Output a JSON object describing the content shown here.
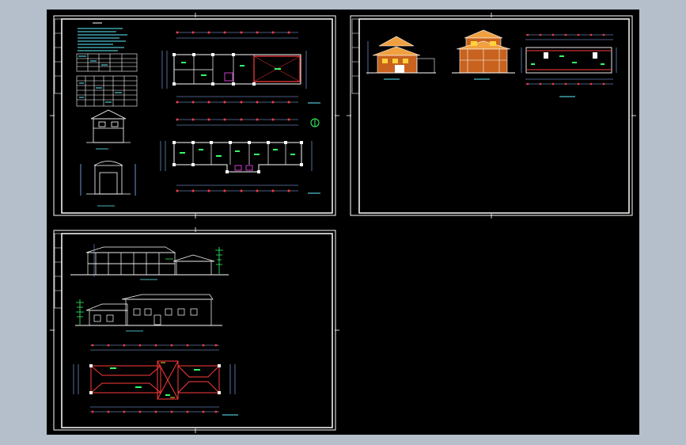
{
  "viewer": {
    "background": "#b5bfcc",
    "canvas_color": "#000000"
  },
  "colors": {
    "frame": "#ffffff",
    "dimension": "#8fb8ff",
    "column": "#ff3b3b",
    "wall": "#ffffff",
    "text_green": "#33ff66",
    "text_cyan": "#5ff0ff",
    "brick": "#c8621e",
    "roof": "#f0a040",
    "yellow": "#ffd23a",
    "magenta": "#ff4dff"
  },
  "sheets": [
    {
      "id": "sheet-1",
      "content": "floor-plans-sections-door-window-schedule"
    },
    {
      "id": "sheet-2",
      "content": "rendered-elevations-roof-plan"
    },
    {
      "id": "sheet-3",
      "content": "elevations-roof-plan"
    }
  ]
}
